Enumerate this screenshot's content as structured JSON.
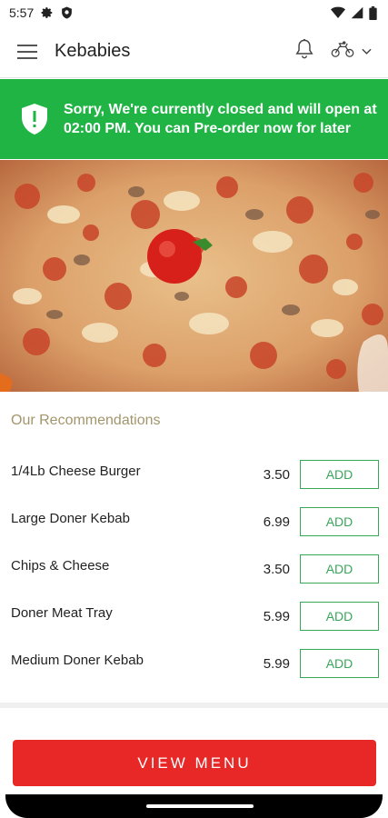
{
  "status_bar": {
    "time": "5:57",
    "left_icons": [
      "gear-icon",
      "shield-icon"
    ],
    "right_icons": [
      "wifi-icon",
      "signal-icon",
      "battery-icon"
    ]
  },
  "app_bar": {
    "title": "Kebabies",
    "icons": [
      "hamburger-menu-icon",
      "bell-icon",
      "rider-icon",
      "chevron-down-icon"
    ]
  },
  "banner": {
    "message": "Sorry, We're currently closed and will open at 02:00 PM. You can Pre-order now for later",
    "icon": "shield-alert-icon",
    "color": "#20b445"
  },
  "recommendations": {
    "title": "Our Recommendations",
    "items": [
      {
        "name": "1/4Lb Cheese Burger",
        "price": "3.50",
        "action": "ADD"
      },
      {
        "name": "Large Doner Kebab",
        "price": "6.99",
        "action": "ADD"
      },
      {
        "name": "Chips & Cheese",
        "price": "3.50",
        "action": "ADD"
      },
      {
        "name": "Doner Meat Tray",
        "price": "5.99",
        "action": "ADD"
      },
      {
        "name": "Medium Doner Kebab",
        "price": "5.99",
        "action": "ADD"
      }
    ]
  },
  "view_menu": {
    "label": "VIEW MENU",
    "color": "#e82727"
  }
}
